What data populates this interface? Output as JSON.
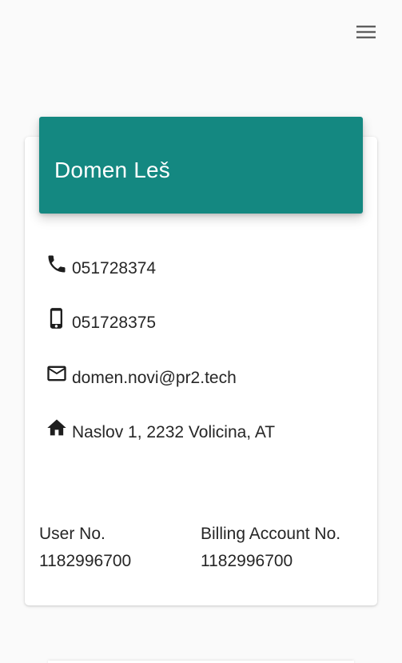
{
  "header": {
    "menu_icon": "hamburger-menu-icon"
  },
  "profile": {
    "name": "Domen Leš",
    "header_color": "#148881",
    "phone": "051728374",
    "mobile": "051728375",
    "email": "domen.novi@pr2.tech",
    "address": "Naslov 1, 2232 Volicina, AT",
    "icons": {
      "phone": "phone-icon",
      "mobile": "smartphone-icon",
      "email": "mail-icon",
      "address": "home-icon"
    }
  },
  "account": {
    "user_no_label": "User No.",
    "user_no_value": "1182996700",
    "billing_label": "Billing Account No.",
    "billing_value": "1182996700"
  }
}
